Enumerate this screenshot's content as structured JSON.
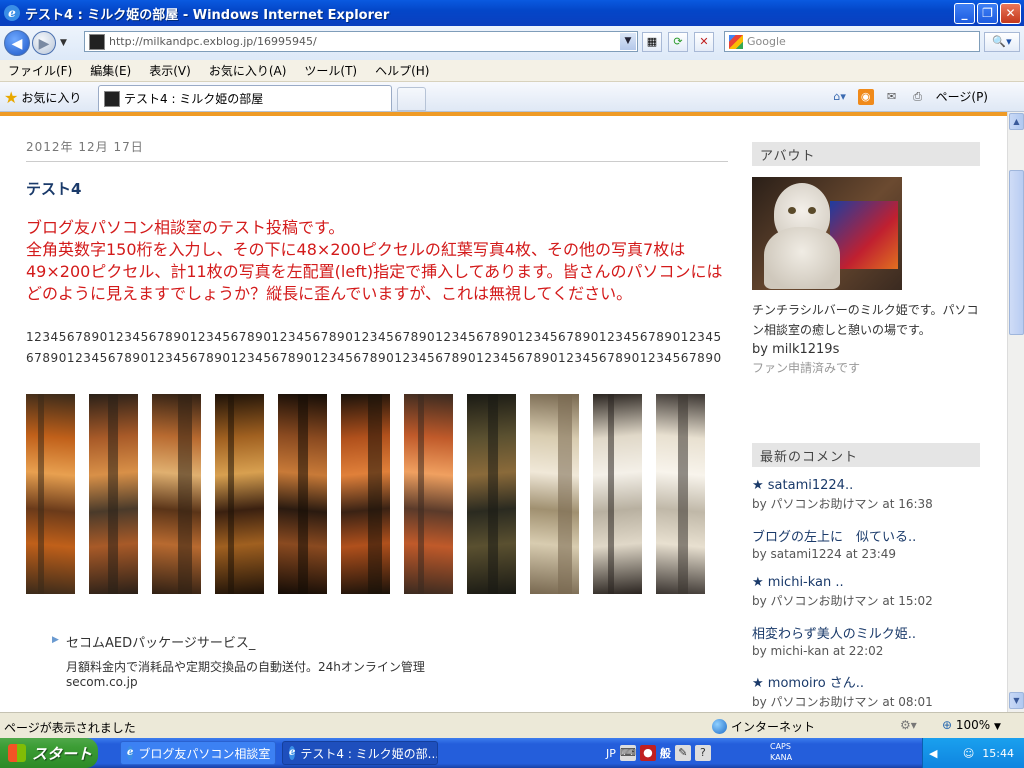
{
  "window": {
    "title": "テスト4 : ミルク姫の部屋 - Windows Internet Explorer",
    "buttons": {
      "minimize": "_",
      "restore": "❐",
      "close": "✕"
    }
  },
  "nav": {
    "back_glyph": "◀",
    "forward_glyph": "▶",
    "url": "http://milkandpc.exblog.jp/16995945/",
    "search_placeholder": "Google"
  },
  "menu": [
    "ファイル(F)",
    "編集(E)",
    "表示(V)",
    "お気に入り(A)",
    "ツール(T)",
    "ヘルプ(H)"
  ],
  "tabs": {
    "favorites_label": "お気に入り",
    "active_tab": "テスト4 : ミルク姫の部屋",
    "page_menu": "ページ(P)"
  },
  "post": {
    "date": "2012年 12月 17日",
    "title": "テスト4",
    "body_line1": "ブログ友パソコン相談室のテスト投稿です。",
    "body_part_a": "全角英数字150桁を入力し、その下に",
    "body_em_a": "48×200",
    "body_part_b": "ピクセルの紅葉写真4枚、その他の写真7枚は",
    "body_em_b": "49×200",
    "body_part_c": "ピクセル、計11枚の写真を左配置(",
    "body_em_c": "left",
    "body_part_d": ")指定で挿入してあります。皆さんのパソコンにはどのように見えますでしょうか？縦長に歪んでいますが、これは無視してください。",
    "digits": "12345678901234567890123456789012345678901234567890123456789012345678901234567890123456789012345678901234567890123456789012345678901234567890123456789012345678901234567890"
  },
  "photos": [
    {
      "name": "autumn-photo-1",
      "palette": [
        "#6a3a1a",
        "#c0601a",
        "#e8a050",
        "#3a2a1a"
      ]
    },
    {
      "name": "autumn-photo-2",
      "palette": [
        "#4a3a2a",
        "#a85a28",
        "#d89048",
        "#2a2018"
      ]
    },
    {
      "name": "autumn-photo-3",
      "palette": [
        "#5a3418",
        "#b86a30",
        "#e0b070",
        "#302014"
      ]
    },
    {
      "name": "autumn-photo-4",
      "palette": [
        "#3a2010",
        "#a06020",
        "#d8a050",
        "#1e1208"
      ]
    },
    {
      "name": "tree-photo-5",
      "palette": [
        "#2a1a10",
        "#8a4a20",
        "#c87a38",
        "#140c06"
      ]
    },
    {
      "name": "tree-photo-6",
      "palette": [
        "#3a2214",
        "#b0501c",
        "#e0803a",
        "#1a120a"
      ]
    },
    {
      "name": "autumn-photo-7",
      "palette": [
        "#5a3a2a",
        "#c05a2a",
        "#f0a060",
        "#3a2a20"
      ]
    },
    {
      "name": "path-photo-8",
      "palette": [
        "#2a2a20",
        "#5a5030",
        "#8a6a3a",
        "#1a1a14"
      ]
    },
    {
      "name": "cat-photo-9",
      "palette": [
        "#a09070",
        "#d8ccb0",
        "#f0e8d8",
        "#786850"
      ]
    },
    {
      "name": "cat-photo-10",
      "palette": [
        "#b8b0a0",
        "#e0d8c8",
        "#f4f0e8",
        "#2a2420"
      ]
    },
    {
      "name": "cat-photo-11",
      "palette": [
        "#c0b8a8",
        "#e8e0d0",
        "#f8f4ec",
        "#3a3430"
      ]
    }
  ],
  "ad": {
    "title": "セコムAEDパッケージサービス_",
    "description": "月額料金内で消耗品や定期交換品の自動送付。24hオンライン管理",
    "url": "secom.co.jp"
  },
  "sidebar": {
    "about_header": "アバウト",
    "about_text": "チンチラシルバーのミルク姫です。パソコン相談室の癒しと憩いの場です。",
    "user": "by milk1219s",
    "fan": "ファン申請済みです",
    "comments_header": "最新のコメント",
    "comments": [
      {
        "title": "★ satami1224..",
        "meta": "by パソコンお助けマン at 16:38"
      },
      {
        "title": "ブログの左上に　似ている..",
        "meta": "by satami1224 at 23:49"
      },
      {
        "title": "★ michi-kan ..",
        "meta": "by パソコンお助けマン at 15:02"
      },
      {
        "title": "相変わらず美人のミルク姫..",
        "meta": "by michi-kan at 22:02"
      },
      {
        "title": "★ momoiro さん..",
        "meta": "by パソコンお助けマン at 08:01"
      }
    ]
  },
  "status": {
    "text": "ページが表示されました",
    "zone": "インターネット",
    "zoom": "100%"
  },
  "taskbar": {
    "start": "スタート",
    "task1": "ブログ友パソコン相談室 ...",
    "task2": "テスト4 : ミルク姫の部...",
    "ime_lang": "JP",
    "ime_mode": "般",
    "caps": "CAPS",
    "kana": "KANA",
    "clock": "15:44"
  }
}
